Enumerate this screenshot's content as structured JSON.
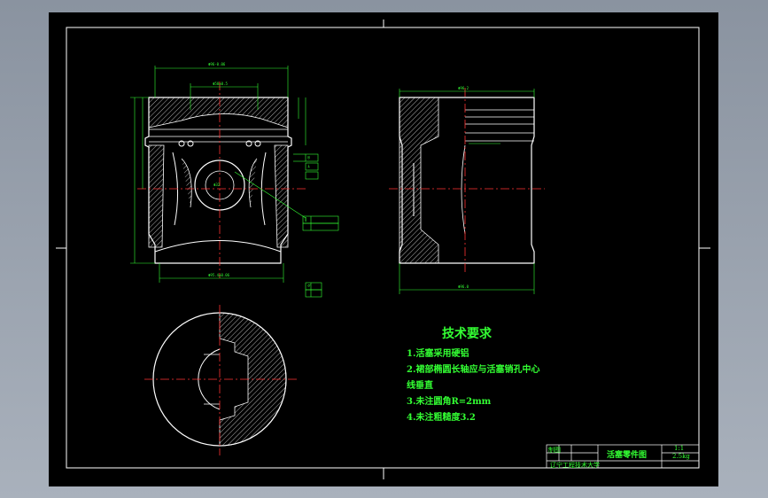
{
  "colors": {
    "background": "#8a93a0",
    "sheet": "#000000",
    "outline": "#ffffff",
    "dimension": "#33ff33",
    "centerline": "#ff3333",
    "hatch": "#ffffff",
    "text": "#33ff33"
  },
  "technical_requirements": {
    "title": "技术要求",
    "items": [
      "1.活塞采用硬铝",
      "2.裙部椭圆长轴应与活塞销孔中心",
      "线垂直",
      "3.未注圆角R=2mm",
      "4.未注粗糙度3.2"
    ]
  },
  "title_block": {
    "drawing_name": "活塞零件图",
    "scale": "1:1",
    "mass": "2.5kg",
    "row1_label": "制图",
    "row1_value": "",
    "school": "辽宁工程技术大学"
  },
  "gdt_frames": {
    "a": "◎",
    "b": "⊥",
    "c": "∥",
    "d": "⌭"
  }
}
